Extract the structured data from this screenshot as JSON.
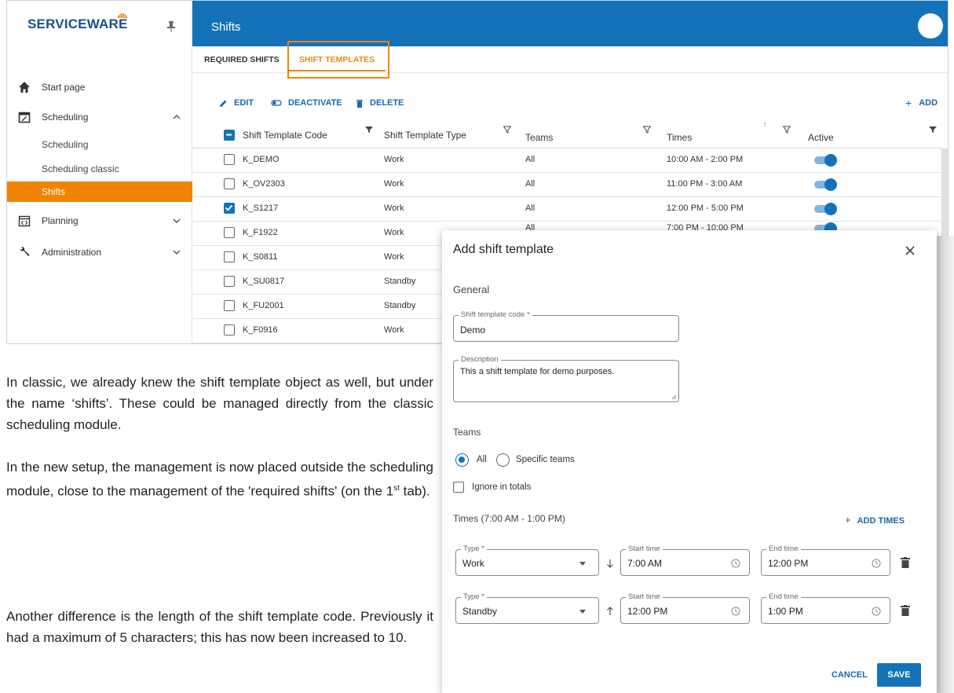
{
  "app": {
    "logo": "SERVICEWARE",
    "page_title": "Shifts"
  },
  "sidebar": {
    "start_page": "Start page",
    "scheduling": "Scheduling",
    "sub_items": [
      "Scheduling",
      "Scheduling classic",
      "Shifts"
    ],
    "planning": "Planning",
    "administration": "Administration"
  },
  "tabs": [
    "REQUIRED SHIFTS",
    "SHIFT TEMPLATES"
  ],
  "toolbar": {
    "edit": "EDIT",
    "deactivate": "DEACTIVATE",
    "delete": "DELETE",
    "add": "ADD"
  },
  "table": {
    "columns": [
      "Shift Template Code",
      "Shift Template Type",
      "Teams",
      "Times",
      "Active"
    ],
    "rows": [
      {
        "code": "K_DEMO",
        "type": "Work",
        "teams": "All",
        "times": "10:00 AM - 2:00 PM",
        "checked": false,
        "active": true
      },
      {
        "code": "K_OV2303",
        "type": "Work",
        "teams": "All",
        "times": "11:00 PM - 3:00 AM",
        "checked": false,
        "active": true
      },
      {
        "code": "K_S1217",
        "type": "Work",
        "teams": "All",
        "times": "12:00 PM - 5:00 PM",
        "checked": true,
        "active": true
      },
      {
        "code": "K_F1922",
        "type": "Work",
        "teams": "All",
        "times": "7:00 PM - 10:00 PM",
        "checked": false,
        "active": true
      },
      {
        "code": "K_S0811",
        "type": "Work",
        "teams": "",
        "times": "",
        "checked": false,
        "active": false
      },
      {
        "code": "K_SU0817",
        "type": "Standby",
        "teams": "",
        "times": "",
        "checked": false,
        "active": false
      },
      {
        "code": "K_FU2001",
        "type": "Standby",
        "teams": "",
        "times": "",
        "checked": false,
        "active": false
      },
      {
        "code": "K_F0916",
        "type": "Work",
        "teams": "",
        "times": "",
        "checked": false,
        "active": false
      }
    ]
  },
  "text": {
    "p1": "In classic, we already knew the shift template object as well, but under the name ‘shifts’. These could be managed directly from the classic scheduling module.",
    "p2a": "In the new setup, the management is now placed outside the scheduling module, close to the management of the 'required shifts' (on the 1",
    "p2_sup": "st",
    "p2b": " tab).",
    "p3": "Another difference is the length of the shift template code. Previously it had a maximum of 5 characters; this has now been increased to 10."
  },
  "modal": {
    "title": "Add shift template",
    "general": "General",
    "code_label": "Shift template code *",
    "code_value": "Demo",
    "description_label": "Description",
    "description_value": "This a shift template for demo purposes.",
    "teams": "Teams",
    "radio_all": "All",
    "radio_specific": "Specific teams",
    "ignore_totals": "Ignore in totals",
    "times_heading": "Times (7:00 AM - 1:00 PM)",
    "add_times": "ADD TIMES",
    "type_label": "Type *",
    "start_label": "Start time",
    "end_label": "End time",
    "time_rows": [
      {
        "type": "Work",
        "start": "7:00 AM",
        "end": "12:00 PM"
      },
      {
        "type": "Standby",
        "start": "12:00 PM",
        "end": "1:00 PM"
      }
    ],
    "cancel": "CANCEL",
    "save": "SAVE"
  },
  "colors": {
    "brand_blue": "#1473b8",
    "accent_orange": "#f08300"
  }
}
